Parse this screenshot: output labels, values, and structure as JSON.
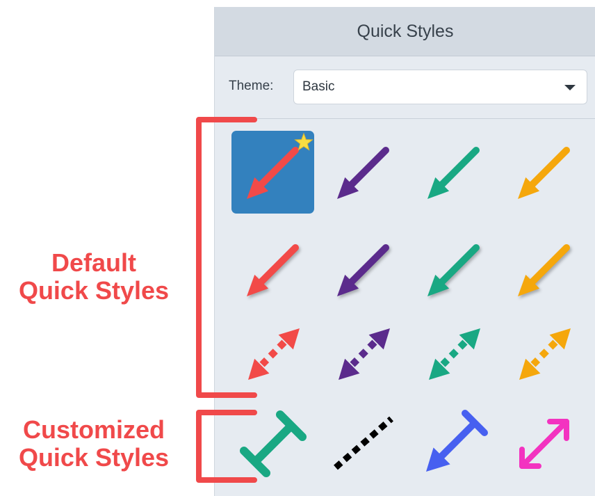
{
  "panel": {
    "title": "Quick Styles",
    "theme_label": "Theme:",
    "theme_value": "Basic",
    "theme_dropdown_icon": "chevron-down-icon"
  },
  "annotations": {
    "default_line1": "Default",
    "default_line2": "Quick Styles",
    "custom_line1": "Customized",
    "custom_line2": "Quick Styles",
    "color": "#f0494a"
  },
  "colors": {
    "red": "#f24a48",
    "purple": "#5b2b8c",
    "green": "#19a883",
    "orange": "#f5a70c",
    "blue": "#4760f0",
    "pink": "#f333c0",
    "black": "#000000",
    "star": "#f7dd43",
    "selection": "#3381be"
  },
  "styles": [
    {
      "id": "red-solid-arrow",
      "group": "default",
      "icon": "arrow-icon",
      "color": "red",
      "selected": true,
      "favorite": true
    },
    {
      "id": "purple-solid-arrow",
      "group": "default",
      "icon": "arrow-icon",
      "color": "purple"
    },
    {
      "id": "green-solid-arrow",
      "group": "default",
      "icon": "arrow-icon",
      "color": "green"
    },
    {
      "id": "orange-solid-arrow",
      "group": "default",
      "icon": "arrow-icon",
      "color": "orange"
    },
    {
      "id": "red-shadow-arrow",
      "group": "default",
      "icon": "arrow-icon",
      "color": "red"
    },
    {
      "id": "purple-shadow-arrow",
      "group": "default",
      "icon": "arrow-icon",
      "color": "purple"
    },
    {
      "id": "green-shadow-arrow",
      "group": "default",
      "icon": "arrow-icon",
      "color": "green"
    },
    {
      "id": "orange-shadow-arrow",
      "group": "default",
      "icon": "arrow-icon",
      "color": "orange"
    },
    {
      "id": "red-dashed-double-arrow",
      "group": "default",
      "icon": "double-arrow-dashed-icon",
      "color": "red"
    },
    {
      "id": "purple-dashed-double-arrow",
      "group": "default",
      "icon": "double-arrow-dashed-icon",
      "color": "purple"
    },
    {
      "id": "green-dashed-double-arrow",
      "group": "default",
      "icon": "double-arrow-dashed-icon",
      "color": "green"
    },
    {
      "id": "orange-dashed-double-arrow",
      "group": "default",
      "icon": "double-arrow-dashed-icon",
      "color": "orange"
    },
    {
      "id": "green-bar-line",
      "group": "customized",
      "icon": "bar-ended-line-icon",
      "color": "green"
    },
    {
      "id": "black-dashed-line",
      "group": "customized",
      "icon": "dashed-line-icon",
      "color": "black"
    },
    {
      "id": "blue-arrow-bar",
      "group": "customized",
      "icon": "arrow-bar-icon",
      "color": "blue"
    },
    {
      "id": "pink-open-double-arrow",
      "group": "customized",
      "icon": "open-double-arrow-icon",
      "color": "pink"
    }
  ]
}
